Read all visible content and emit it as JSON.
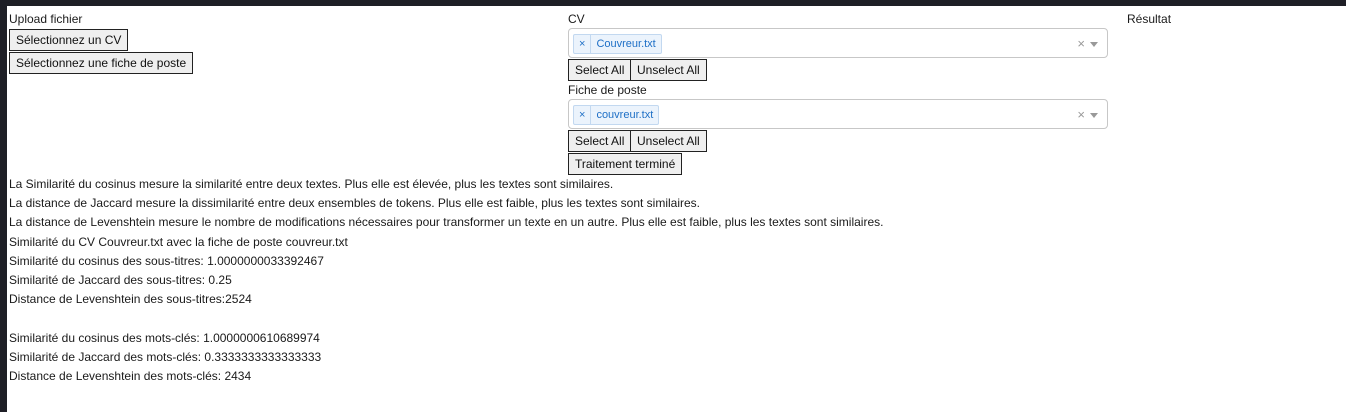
{
  "upload": {
    "title": "Upload fichier",
    "select_cv_button": "Sélectionnez un CV",
    "select_job_button": "Sélectionnez une fiche de poste"
  },
  "cv": {
    "label": "CV",
    "selected": "Couvreur.txt",
    "select_all": "Select All",
    "unselect_all": "Unselect All"
  },
  "job": {
    "label": "Fiche de poste",
    "selected": "couvreur.txt",
    "select_all": "Select All",
    "unselect_all": "Unselect All",
    "status_button": "Traitement terminé"
  },
  "result": {
    "title": "Résultat"
  },
  "icons": {
    "remove": "×",
    "clear": "×"
  },
  "explanations": [
    "La Similarité du cosinus mesure la similarité entre deux textes. Plus elle est élevée, plus les textes sont similaires.",
    "La distance de Jaccard mesure la dissimilarité entre deux ensembles de tokens. Plus elle est faible, plus les textes sont similaires.",
    "La distance de Levenshtein mesure le nombre de modifications nécessaires pour transformer un texte en un autre. Plus elle est faible, plus les textes sont similaires."
  ],
  "results": {
    "heading": "Similarité du CV Couvreur.txt avec la fiche de poste couvreur.txt",
    "subtitles": [
      "Similarité du cosinus des sous-titres: 1.0000000033392467",
      "Similarité de Jaccard des sous-titres: 0.25",
      "Distance de Levenshtein des sous-titres:2524"
    ],
    "keywords": [
      "Similarité du cosinus des mots-clés: 1.0000000610689974",
      "Similarité de Jaccard des mots-clés: 0.3333333333333333",
      "Distance de Levenshtein des mots-clés: 2434"
    ]
  },
  "colors": {
    "background": "#1e1f26",
    "tag_text": "#1e6fc6",
    "tag_bg": "#ebf3fc"
  }
}
